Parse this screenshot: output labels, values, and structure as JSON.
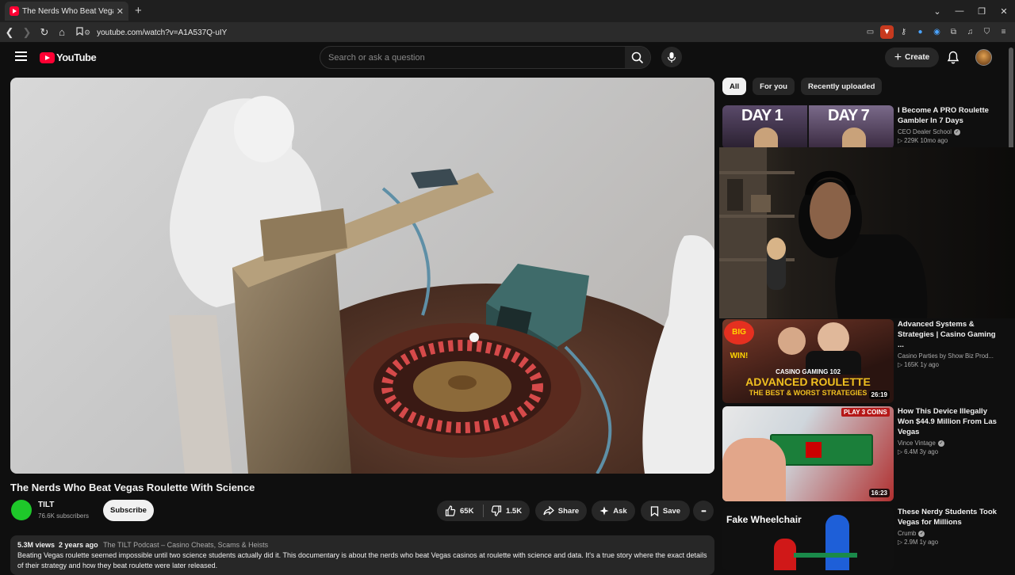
{
  "browser": {
    "tab_title": "The Nerds Who Beat Vegas R",
    "tab_close": "✕",
    "new_tab": "+",
    "url": "youtube.com/watch?v=A1A537Q-uIY",
    "window_controls": [
      "⌄",
      "—",
      "❐",
      "✕"
    ]
  },
  "masthead": {
    "logo_text": "YouTube",
    "search_placeholder": "Search or ask a question",
    "create_label": "Create",
    "create_icon": "+"
  },
  "video": {
    "title": "The Nerds Who Beat Vegas Roulette With Science",
    "channel": "TILT",
    "subscribers": "76.6K subscribers",
    "subscribe_label": "Subscribe",
    "likes": "65K",
    "dislikes": "1.5K",
    "share_label": "Share",
    "ask_label": "Ask",
    "save_label": "Save",
    "more_label": "•••",
    "views": "5.3M views",
    "age": "2 years ago",
    "playlist_tag": "The TILT Podcast – Casino Cheats, Scams & Heists",
    "description": "Beating Vegas roulette seemed impossible until two science students actually did it. This documentary is about the nerds who beat Vegas casinos at roulette with science and data. It's a true story where the exact details of their strategy and how they beat roulette were later released."
  },
  "chips": [
    "All",
    "For you",
    "Recently uploaded"
  ],
  "recommendations": [
    {
      "title": "I Become A PRO Roulette Gambler In 7 Days",
      "channel": "CEO Dealer School",
      "stats": "▷ 229K  10mo ago",
      "thumb_left": "DAY 1",
      "thumb_right": "DAY 7",
      "verified": true
    },
    {
      "title": "Advanced Systems & Strategies | Casino Gaming ...",
      "channel": "Casino Parties by Show Biz Prod...",
      "stats": "▷ 165K  1y ago",
      "duration": "26:19",
      "thumb_badge": "BIG WIN!",
      "thumb_sub": "CASINO GAMING 102",
      "thumb_main": "ADVANCED ROULETTE",
      "thumb_foot": "THE BEST & WORST STRATEGIES",
      "verified": false
    },
    {
      "title": "How This Device Illegally Won $44.9 Million From Las Vegas",
      "channel": "Vince Vintage",
      "stats": "▷ 6.4M  3y ago",
      "duration": "16:23",
      "thumb_badge": "PLAY 3 COINS",
      "verified": true
    },
    {
      "title": "These Nerdy Students Took Vegas for Millions",
      "channel": "Crumb",
      "stats": "▷ 2.9M  1y ago",
      "thumb_text": "Fake Wheelchair",
      "verified": true
    }
  ],
  "colors": {
    "background": "#0f0f0f",
    "surface": "#272727",
    "brand_red": "#ff0033",
    "text_secondary": "#aaaaaa"
  }
}
